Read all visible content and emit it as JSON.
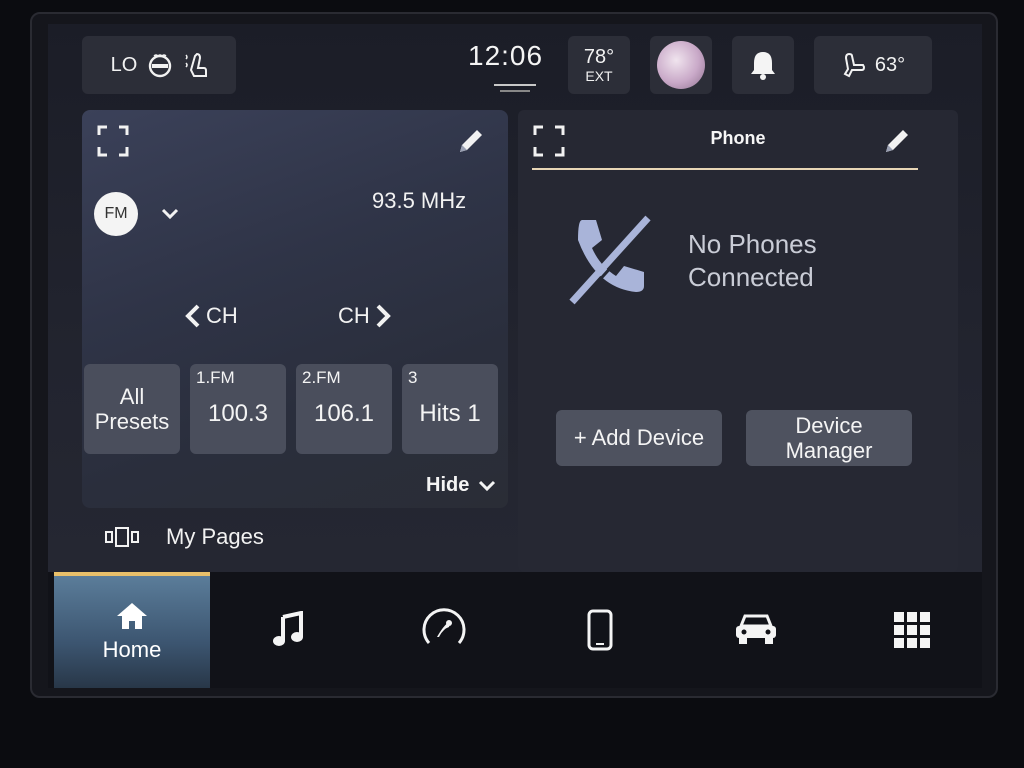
{
  "status_bar": {
    "climate_left": {
      "fan_level": "LO",
      "icons": [
        "steering-wheel-heat-icon",
        "seat-heat-icon"
      ]
    },
    "clock": "12:06",
    "exterior_temp": {
      "value": "78°",
      "label": "EXT"
    },
    "avatar": "profile-avatar",
    "notifications_icon": "bell-icon",
    "climate_right": {
      "icon": "seat-icon",
      "temp": "63°"
    }
  },
  "radio": {
    "band": "FM",
    "frequency": "93.5 MHz",
    "ch_prev_label": "CH",
    "ch_next_label": "CH",
    "presets": {
      "all_label": "All Presets",
      "items": [
        {
          "label": "1.FM",
          "value": "100.3"
        },
        {
          "label": "2.FM",
          "value": "106.1"
        },
        {
          "label": "3",
          "value": "Hits 1"
        }
      ]
    },
    "hide_label": "Hide"
  },
  "my_pages": {
    "label": "My Pages"
  },
  "phone": {
    "title": "Phone",
    "status_line1": "No Phones",
    "status_line2": "Connected",
    "add_device_label": "+ Add Device",
    "device_manager_label": "Device Manager"
  },
  "nav": {
    "items": [
      {
        "id": "home",
        "label": "Home",
        "icon": "home-icon",
        "active": true
      },
      {
        "id": "media",
        "label": "",
        "icon": "music-note-icon"
      },
      {
        "id": "comfort",
        "label": "",
        "icon": "comfort-icon"
      },
      {
        "id": "phone",
        "label": "",
        "icon": "phone-icon"
      },
      {
        "id": "vehicle",
        "label": "",
        "icon": "car-icon"
      },
      {
        "id": "apps",
        "label": "",
        "icon": "apps-grid-icon"
      }
    ]
  },
  "colors": {
    "accent_home_bar": "#e9c06a",
    "phone_divider": "#e8d6b6",
    "no_phone_icon": "#a9b4d9"
  }
}
